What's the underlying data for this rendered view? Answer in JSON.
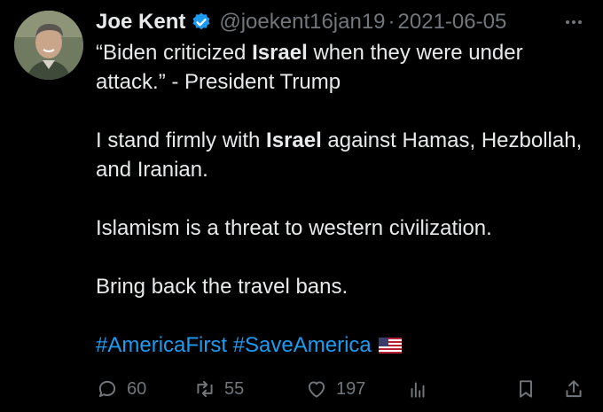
{
  "tweet": {
    "author": {
      "name": "Joe Kent",
      "handle": "@joekent16jan19",
      "verified": true,
      "separator": "·",
      "date": "2021-06-05"
    },
    "body": {
      "p1_a": "“Biden criticized ",
      "p1_b": "Israel",
      "p1_c": " when they were under attack.” - President Trump",
      "p2_a": "I stand firmly with ",
      "p2_b": "Israel",
      "p2_c": " against Hamas, Hezbollah, and Iranian.",
      "p3": "Islamism is a threat to western civilization.",
      "p4": "Bring back the travel bans.",
      "hashtag_1": "#AmericaFirst",
      "hashtag_2": "#SaveAmerica"
    },
    "metrics": {
      "replies": "60",
      "retweets": "55",
      "likes": "197"
    }
  },
  "colors": {
    "background": "#000000",
    "text": "#e7e9ea",
    "secondary": "#71767b",
    "accent": "#1d9bf0"
  },
  "icons": [
    "verified-icon",
    "more-icon",
    "reply-icon",
    "retweet-icon",
    "like-icon",
    "views-icon",
    "bookmark-icon",
    "share-icon",
    "us-flag-icon"
  ]
}
